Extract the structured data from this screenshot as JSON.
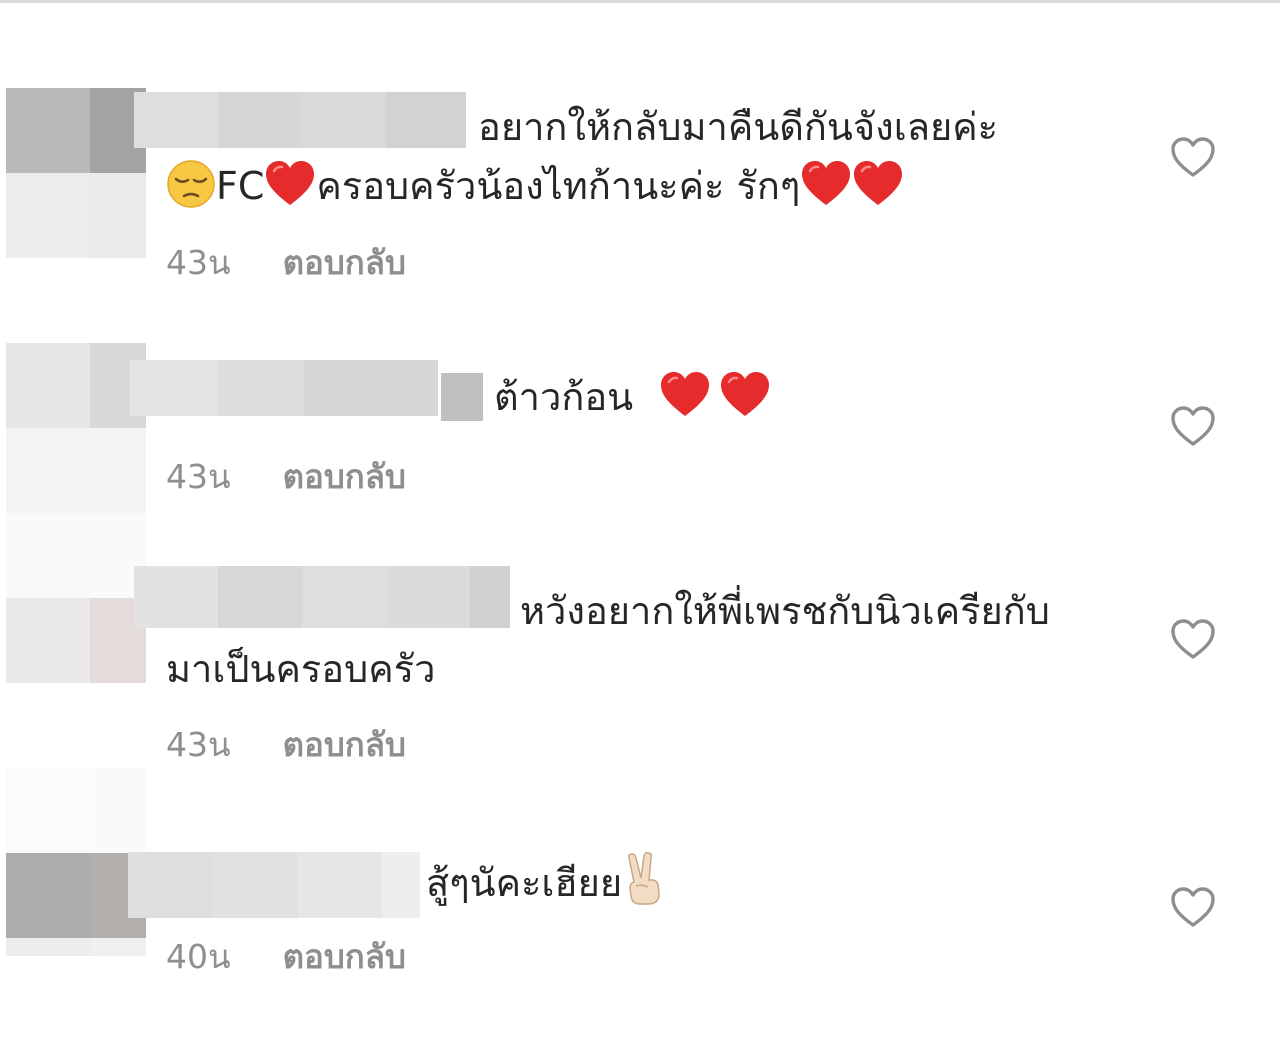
{
  "comments": [
    {
      "line1": "อยากให้กลับมาคืนดีกันจังเลยค่ะ",
      "line2_prefix": "FC",
      "line2_text": "ครอบครัวน้องไทก้านะค่ะ รักๆ",
      "time": "43น",
      "reply_label": "ตอบกลับ",
      "emojis": [
        "pensive-face",
        "red-heart",
        "red-heart",
        "red-heart"
      ]
    },
    {
      "line1": "ต้าวก้อน",
      "time": "43น",
      "reply_label": "ตอบกลับ",
      "emojis": [
        "red-heart",
        "red-heart"
      ]
    },
    {
      "line1": "หวังอยากให้พี่เพรชกับนิวเครียกับ",
      "line2": "มาเป็นครอบครัว",
      "time": "43น",
      "reply_label": "ตอบกลับ"
    },
    {
      "line1": "สู้ๆนัคะเฮียย",
      "time": "40น",
      "reply_label": "ตอบกลับ",
      "emojis": [
        "victory-hand"
      ]
    }
  ],
  "colors": {
    "text": "#262626",
    "meta": "#8e8e8e",
    "heart_red": "#e52b2b",
    "like_outline": "#8e8e8e"
  },
  "icons": {
    "like": "heart-outline-icon"
  }
}
